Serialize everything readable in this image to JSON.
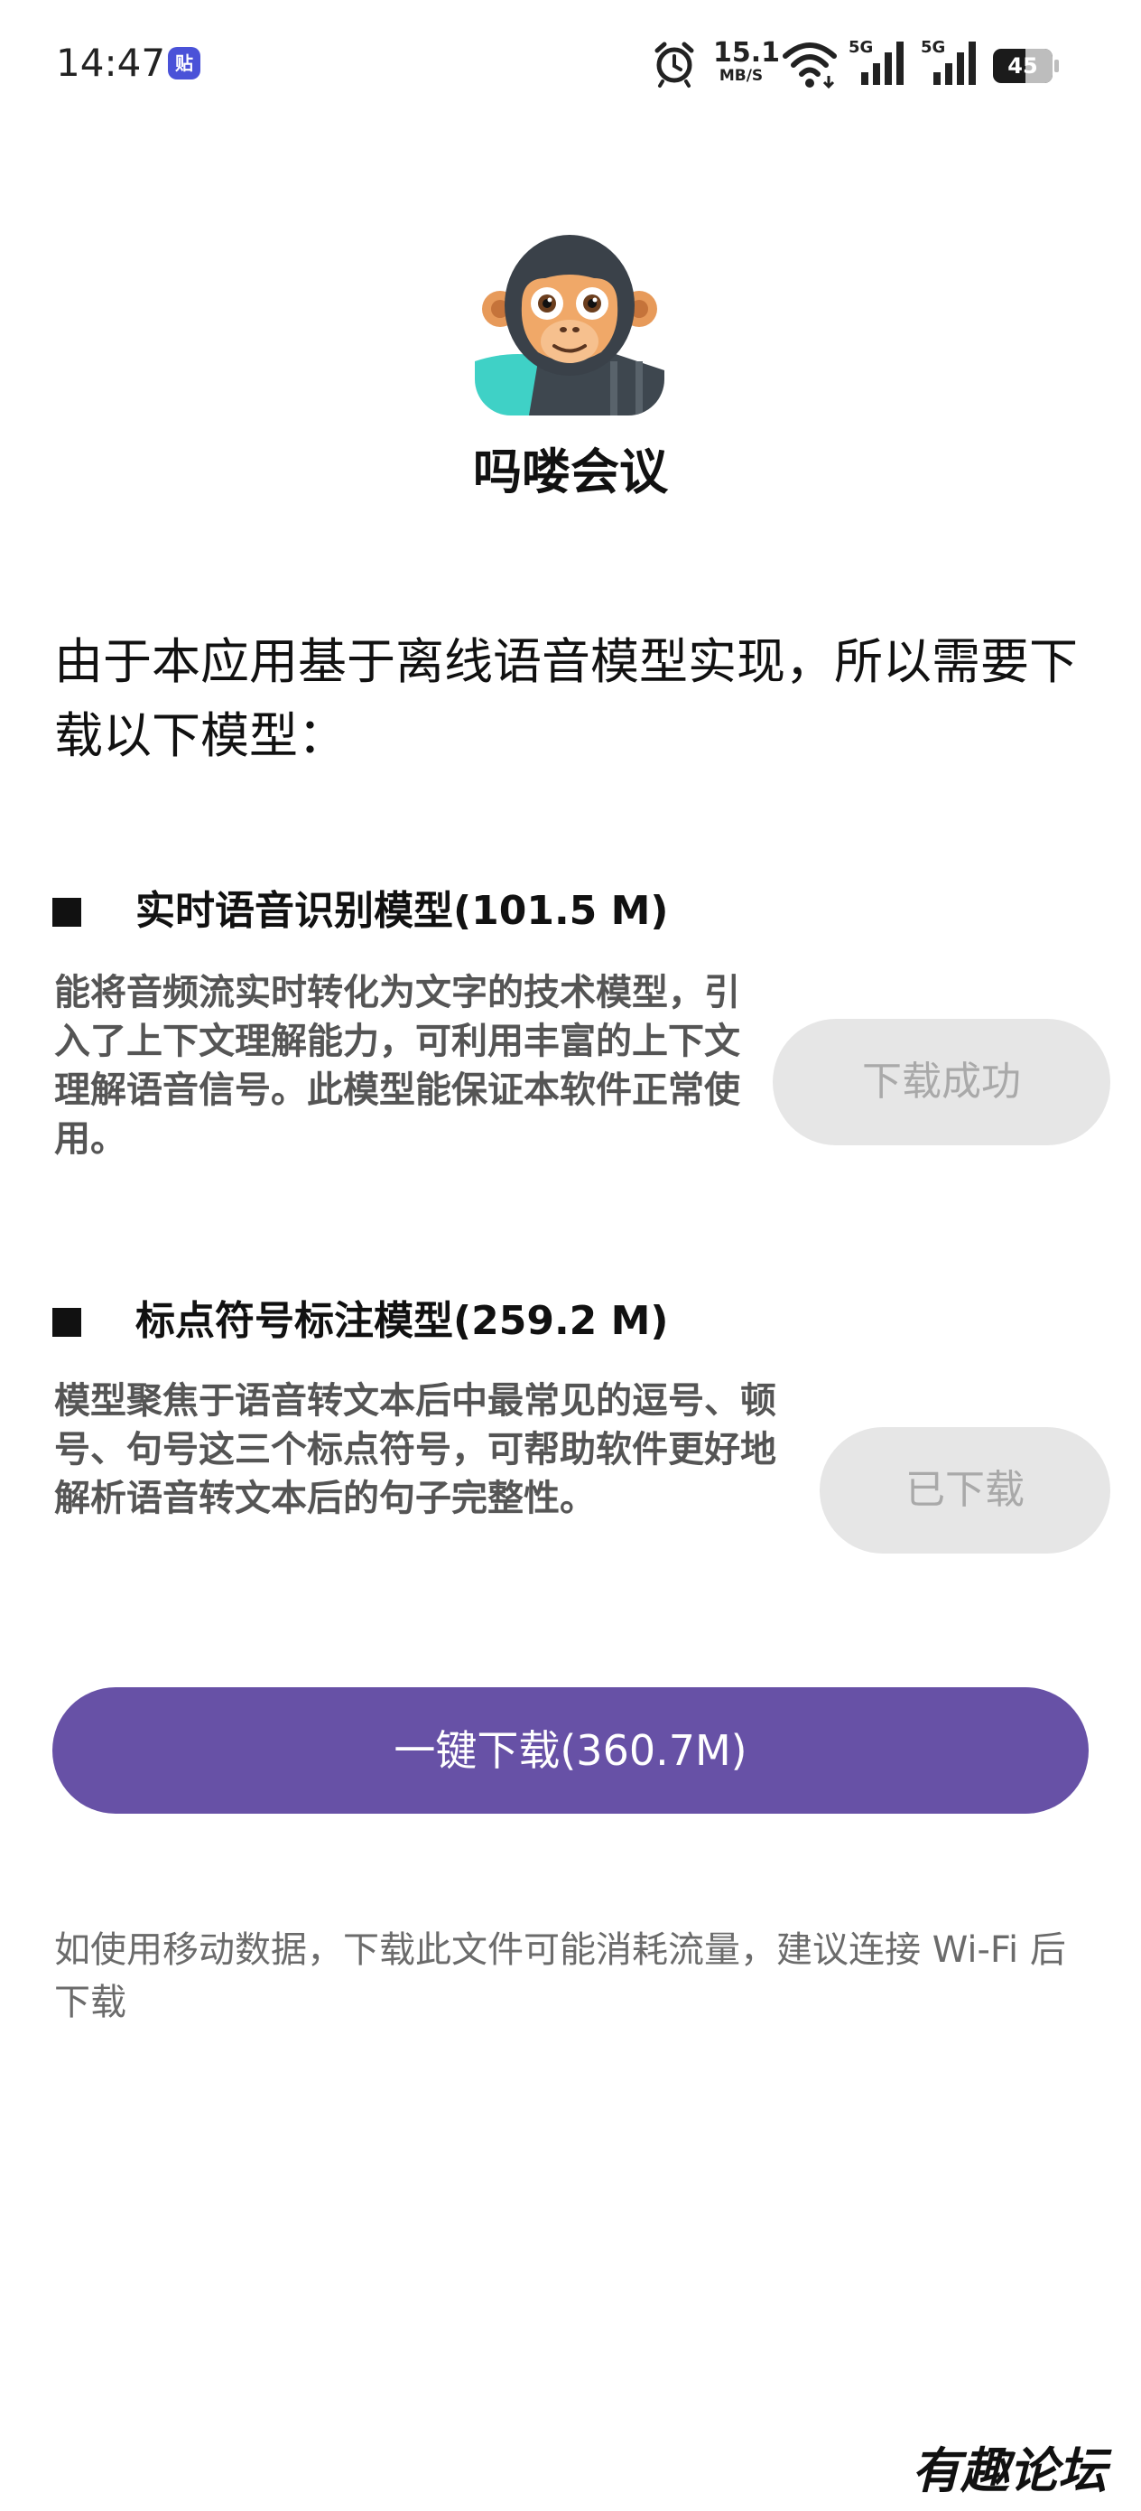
{
  "status_bar": {
    "time": "14:47",
    "notification_badge": "贴",
    "net_speed_value": "15.1",
    "net_speed_unit": "MB/S",
    "signal1_label": "5G",
    "signal2_label": "5G",
    "battery": "45",
    "icons": [
      "alarm-icon",
      "wifi-icon",
      "signal-icon",
      "signal-icon",
      "battery-icon"
    ]
  },
  "app": {
    "name": "吗喽会议",
    "logo": "monkey-logo"
  },
  "intro": {
    "text": "由于本应用基于离线语音模型实现，所以需要下载以下模型："
  },
  "models": [
    {
      "title": "实时语音识别模型(101.5 M)",
      "description": "能将音频流实时转化为文字的技术模型，引入了上下文理解能力，可利用丰富的上下文理解语音信号。此模型能保证本软件正常使用。",
      "button_label": "下载成功"
    },
    {
      "title": "标点符号标注模型(259.2 M)",
      "description": "模型聚焦于语音转文本后中最常见的逗号、顿号、句号这三个标点符号，可帮助软件更好地解析语音转文本后的句子完整性。",
      "button_label": "已下载"
    }
  ],
  "download_all": {
    "label": "一键下载(360.7M)"
  },
  "notice": {
    "text": "如使用移动数据，下载此文件可能消耗流量，建议连接 Wi-Fi 后下载"
  },
  "watermark": {
    "text": "有趣论坛"
  },
  "colors": {
    "primary": "#6751a6",
    "button_disabled_bg": "#e6e6e6",
    "button_disabled_text": "#a9a9a9",
    "description_text": "#555555",
    "notice_text": "#6b6b6b"
  }
}
